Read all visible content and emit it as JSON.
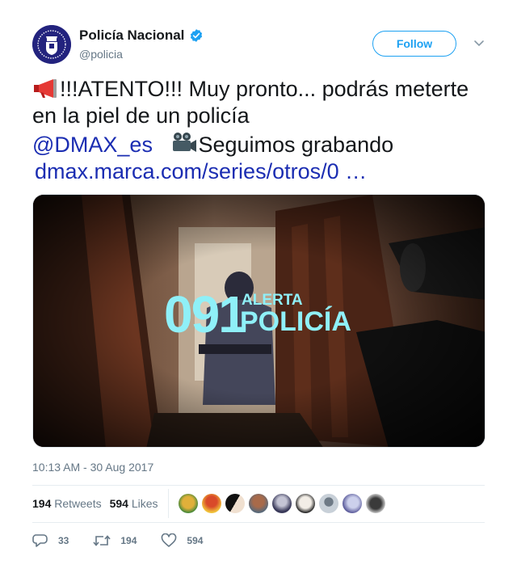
{
  "account": {
    "display_name": "Policía Nacional",
    "handle": "@policia",
    "verified_icon": "verified-badge-icon",
    "accent_color": "#1da1f2"
  },
  "header": {
    "follow_label": "Follow",
    "menu_icon": "chevron-down-icon"
  },
  "tweet": {
    "line1_text": "!!!ATENTO!!! Muy pronto... podrás meterte",
    "line1_emoji": "megaphone-icon",
    "line2_text": "en la piel de un policía",
    "mention": "@DMAX_es",
    "line3_emoji": "movie-camera-icon",
    "line3_text": "Seguimos grabando",
    "url": "dmax.marca.com/series/otros/0 …"
  },
  "media": {
    "overlay_number": "091",
    "overlay_word1": "ALERTA",
    "overlay_word2": "POLICÍA",
    "overlay_color": "#8ff0f8"
  },
  "timestamp": "10:13 AM - 30 Aug 2017",
  "stats": {
    "retweets_count": "194",
    "retweets_label": "Retweets",
    "likes_count": "594",
    "likes_label": "Likes"
  },
  "actions": {
    "replies": "33",
    "retweets": "194",
    "likes": "594"
  }
}
